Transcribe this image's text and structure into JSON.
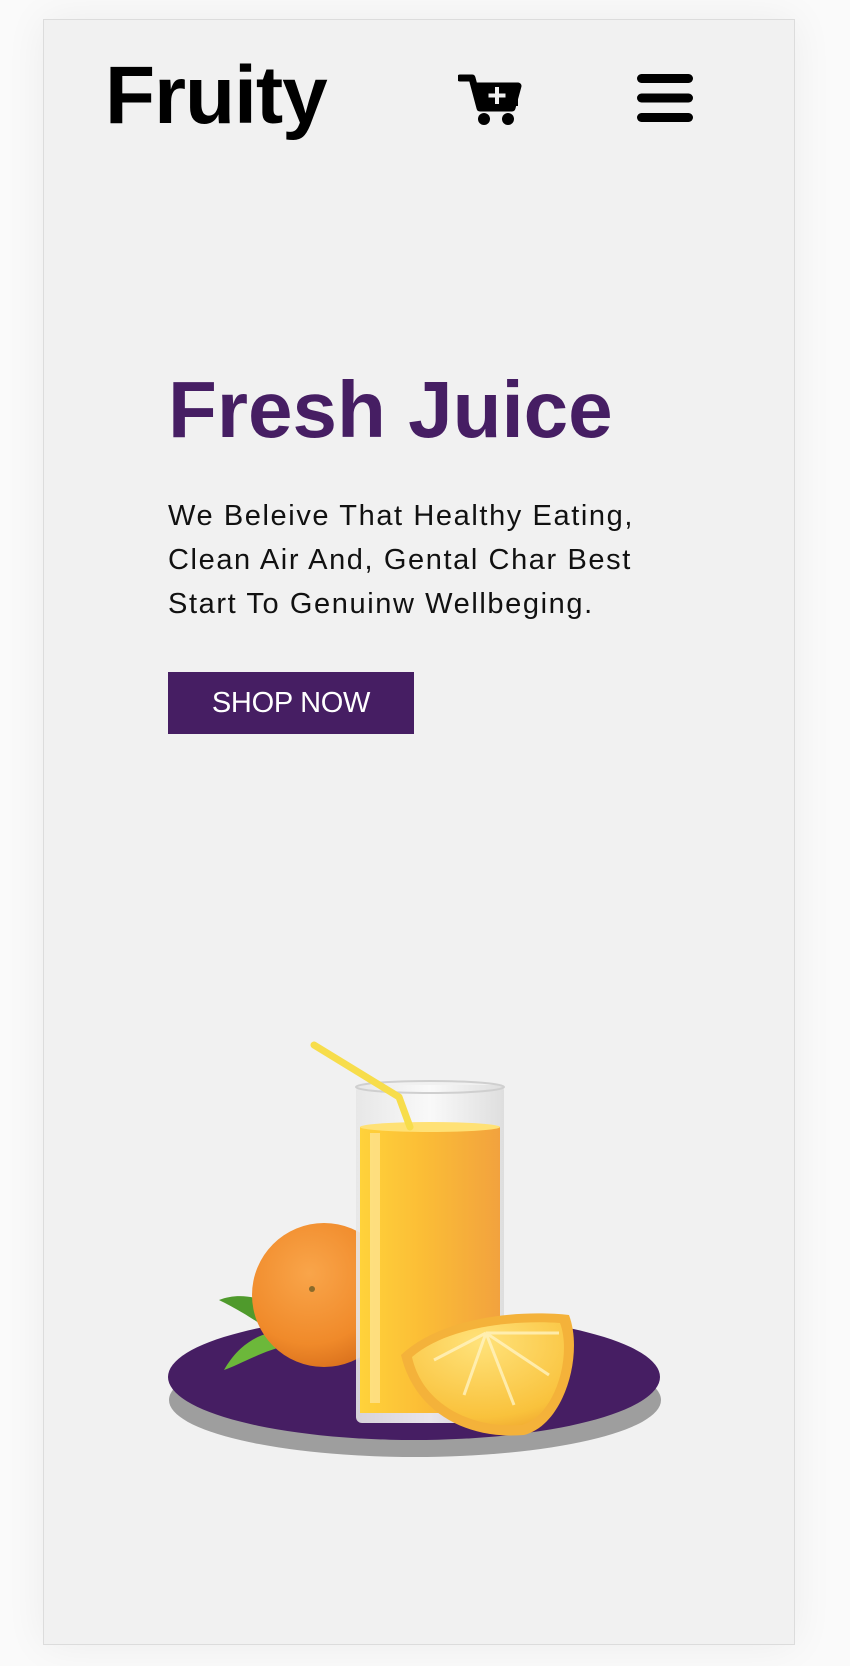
{
  "header": {
    "logo": "Fruity",
    "cart_icon": "cart-plus-icon",
    "menu_icon": "hamburger-menu-icon"
  },
  "hero": {
    "title": "Fresh Juice",
    "description": "We Beleive That Healthy Eating, Clean Air And, Gental Char Best Start To Genuinw Wellbeging.",
    "cta_label": "SHOP NOW"
  },
  "colors": {
    "brand": "#461e63",
    "background": "#f1f1f1",
    "text": "#000000"
  }
}
